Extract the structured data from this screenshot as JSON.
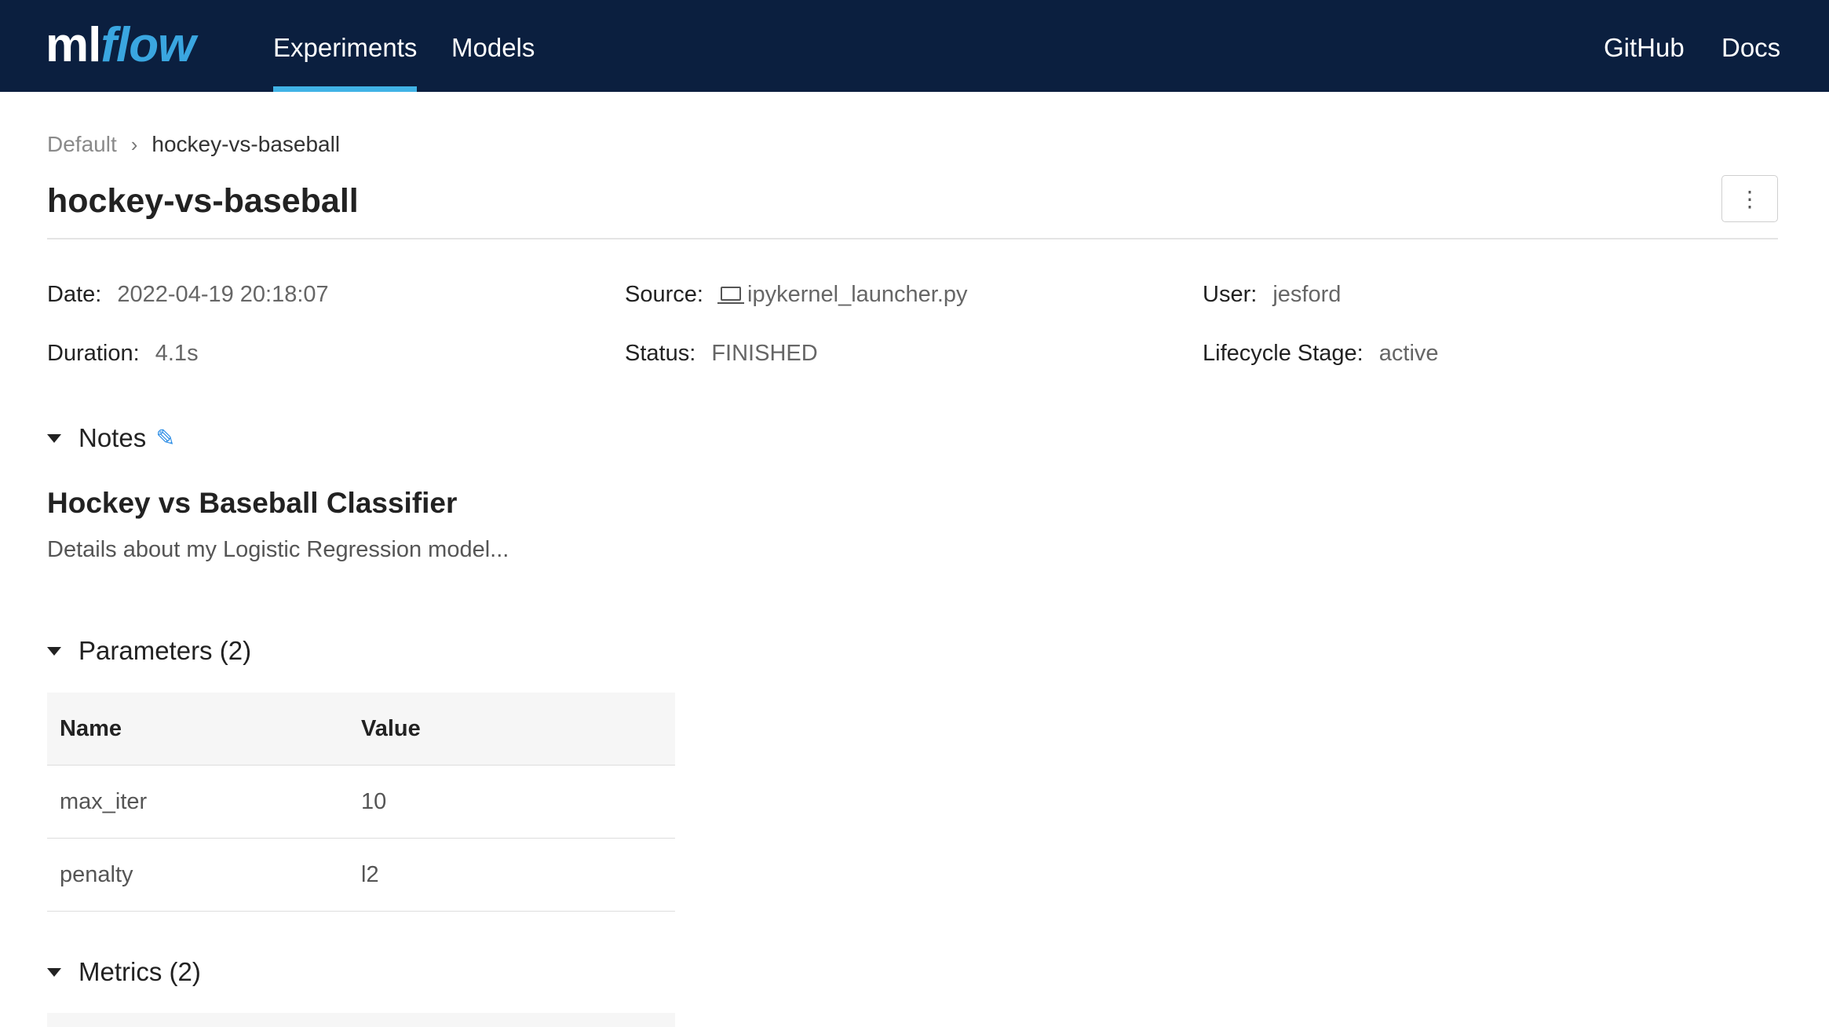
{
  "header": {
    "logo_ml": "ml",
    "logo_flow": "flow",
    "nav": [
      "Experiments",
      "Models"
    ],
    "links": [
      "GitHub",
      "Docs"
    ]
  },
  "breadcrumb": {
    "parent": "Default",
    "current": "hockey-vs-baseball"
  },
  "page_title": "hockey-vs-baseball",
  "menu_icon": "⋮",
  "meta": {
    "date_label": "Date",
    "date_value": "2022-04-19 20:18:07",
    "source_label": "Source",
    "source_value": "ipykernel_launcher.py",
    "user_label": "User",
    "user_value": "jesford",
    "duration_label": "Duration",
    "duration_value": "4.1s",
    "status_label": "Status",
    "status_value": "FINISHED",
    "lifecycle_label": "Lifecycle Stage",
    "lifecycle_value": "active"
  },
  "notes": {
    "heading": "Notes",
    "title": "Hockey vs Baseball Classifier",
    "body": "Details about my Logistic Regression model..."
  },
  "parameters": {
    "heading": "Parameters (2)",
    "columns": [
      "Name",
      "Value"
    ],
    "rows": [
      {
        "name": "max_iter",
        "value": "10"
      },
      {
        "name": "penalty",
        "value": "l2"
      }
    ]
  },
  "metrics": {
    "heading": "Metrics (2)"
  },
  "colors": {
    "header_bg": "#0b1f3f",
    "accent": "#41b3e6",
    "edit_icon": "#2f8fe6"
  }
}
